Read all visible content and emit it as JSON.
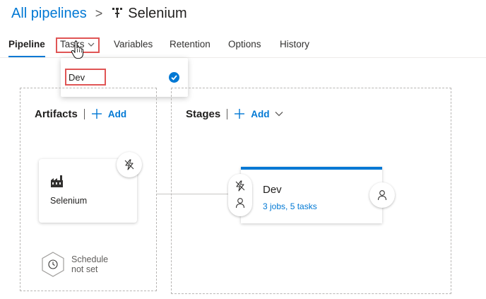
{
  "breadcrumb": {
    "root": "All pipelines",
    "separator": ">",
    "title": "Selenium"
  },
  "tabs": [
    {
      "label": "Pipeline",
      "active": true
    },
    {
      "label": "Tasks",
      "active": false
    },
    {
      "label": "Variables",
      "active": false
    },
    {
      "label": "Retention",
      "active": false
    },
    {
      "label": "Options",
      "active": false
    },
    {
      "label": "History",
      "active": false
    }
  ],
  "tasks_dropdown": {
    "items": [
      {
        "label": "Dev",
        "selected": true
      }
    ]
  },
  "artifacts": {
    "title": "Artifacts",
    "add_label": "Add",
    "card": {
      "name": "Selenium"
    },
    "schedule": {
      "line1": "Schedule",
      "line2": "not set"
    }
  },
  "stages": {
    "title": "Stages",
    "add_label": "Add",
    "stage": {
      "name": "Dev",
      "summary": "3 jobs, 5 tasks"
    }
  },
  "icons": {
    "pipeline": "release-pipeline-icon",
    "trigger": "lightning-icon",
    "approver": "person-icon",
    "schedule": "clock-icon",
    "build": "build-factory-icon",
    "check": "checkmark-circle-icon"
  },
  "colors": {
    "accent": "#0078d4",
    "highlight": "#e05555"
  }
}
